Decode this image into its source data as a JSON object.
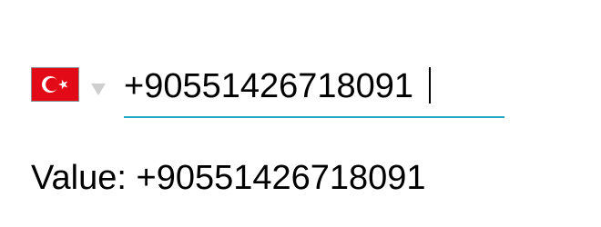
{
  "phone_field": {
    "country": {
      "flag_icon": "turkey-flag-icon",
      "dropdown_icon": "chevron-down-icon",
      "flag_color": "#e30a17"
    },
    "value": "+90551426718091",
    "underline_color": "#1fa9c4"
  },
  "value_display": {
    "label": "Value:",
    "value": "+90551426718091"
  }
}
